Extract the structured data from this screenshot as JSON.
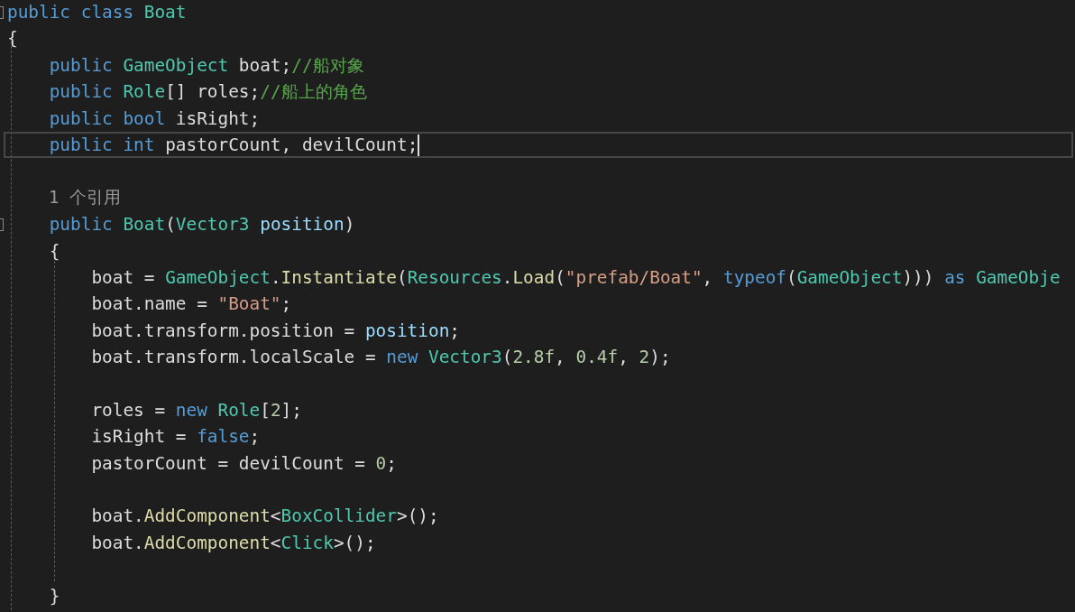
{
  "editor": {
    "lines": [
      {
        "kind": "code",
        "current": false,
        "fold": true,
        "tokens": [
          {
            "text": "public class ",
            "kind": "keyword"
          },
          {
            "text": "Boat",
            "kind": "type"
          }
        ]
      },
      {
        "kind": "code",
        "current": false,
        "fold": false,
        "tokens": [
          {
            "text": "{",
            "kind": "plain"
          }
        ]
      },
      {
        "kind": "code",
        "current": false,
        "fold": false,
        "tokens": [
          {
            "text": "    public ",
            "kind": "keyword"
          },
          {
            "text": "GameObject",
            "kind": "type"
          },
          {
            "text": " boat;",
            "kind": "plain"
          },
          {
            "text": "//船对象",
            "kind": "comment"
          }
        ]
      },
      {
        "kind": "code",
        "current": false,
        "fold": false,
        "tokens": [
          {
            "text": "    public ",
            "kind": "keyword"
          },
          {
            "text": "Role",
            "kind": "type"
          },
          {
            "text": "[] roles;",
            "kind": "plain"
          },
          {
            "text": "//船上的角色",
            "kind": "comment"
          }
        ]
      },
      {
        "kind": "code",
        "current": false,
        "fold": false,
        "tokens": [
          {
            "text": "    public bool ",
            "kind": "keyword"
          },
          {
            "text": "isRight;",
            "kind": "plain"
          }
        ]
      },
      {
        "kind": "code",
        "current": true,
        "fold": false,
        "tokens": [
          {
            "text": "    public int ",
            "kind": "keyword"
          },
          {
            "text": "pastorCount, devilCount;",
            "kind": "plain"
          }
        ]
      },
      {
        "kind": "blank",
        "current": false,
        "fold": false
      },
      {
        "kind": "lens",
        "current": false,
        "fold": false,
        "text": "1 个引用"
      },
      {
        "kind": "code",
        "current": false,
        "fold": true,
        "tokens": [
          {
            "text": "    public ",
            "kind": "keyword"
          },
          {
            "text": "Boat",
            "kind": "type"
          },
          {
            "text": "(",
            "kind": "plain"
          },
          {
            "text": "Vector3 ",
            "kind": "type"
          },
          {
            "text": "position",
            "kind": "param"
          },
          {
            "text": ")",
            "kind": "plain"
          }
        ]
      },
      {
        "kind": "code",
        "current": false,
        "fold": false,
        "tokens": [
          {
            "text": "    {",
            "kind": "plain"
          }
        ]
      },
      {
        "kind": "code",
        "current": false,
        "fold": false,
        "tokens": [
          {
            "text": "        boat = ",
            "kind": "plain"
          },
          {
            "text": "GameObject",
            "kind": "type"
          },
          {
            "text": ".",
            "kind": "plain"
          },
          {
            "text": "Instantiate",
            "kind": "method"
          },
          {
            "text": "(",
            "kind": "plain"
          },
          {
            "text": "Resources",
            "kind": "type"
          },
          {
            "text": ".",
            "kind": "plain"
          },
          {
            "text": "Load",
            "kind": "method"
          },
          {
            "text": "(",
            "kind": "plain"
          },
          {
            "text": "\"prefab/Boat\"",
            "kind": "string"
          },
          {
            "text": ", ",
            "kind": "plain"
          },
          {
            "text": "typeof",
            "kind": "keyword"
          },
          {
            "text": "(",
            "kind": "plain"
          },
          {
            "text": "GameObject",
            "kind": "type"
          },
          {
            "text": "))) ",
            "kind": "plain"
          },
          {
            "text": "as ",
            "kind": "keyword"
          },
          {
            "text": "GameObje",
            "kind": "type"
          }
        ]
      },
      {
        "kind": "code",
        "current": false,
        "fold": false,
        "tokens": [
          {
            "text": "        boat.name = ",
            "kind": "plain"
          },
          {
            "text": "\"Boat\"",
            "kind": "string"
          },
          {
            "text": ";",
            "kind": "plain"
          }
        ]
      },
      {
        "kind": "code",
        "current": false,
        "fold": false,
        "tokens": [
          {
            "text": "        boat.transform.position = ",
            "kind": "plain"
          },
          {
            "text": "position",
            "kind": "param"
          },
          {
            "text": ";",
            "kind": "plain"
          }
        ]
      },
      {
        "kind": "code",
        "current": false,
        "fold": false,
        "tokens": [
          {
            "text": "        boat.transform.localScale = ",
            "kind": "plain"
          },
          {
            "text": "new ",
            "kind": "keyword"
          },
          {
            "text": "Vector3",
            "kind": "type"
          },
          {
            "text": "(",
            "kind": "plain"
          },
          {
            "text": "2.8f",
            "kind": "number"
          },
          {
            "text": ", ",
            "kind": "plain"
          },
          {
            "text": "0.4f",
            "kind": "number"
          },
          {
            "text": ", ",
            "kind": "plain"
          },
          {
            "text": "2",
            "kind": "number"
          },
          {
            "text": ");",
            "kind": "plain"
          }
        ]
      },
      {
        "kind": "blank",
        "current": false,
        "fold": false
      },
      {
        "kind": "code",
        "current": false,
        "fold": false,
        "tokens": [
          {
            "text": "        roles = ",
            "kind": "plain"
          },
          {
            "text": "new ",
            "kind": "keyword"
          },
          {
            "text": "Role",
            "kind": "type"
          },
          {
            "text": "[",
            "kind": "plain"
          },
          {
            "text": "2",
            "kind": "number"
          },
          {
            "text": "];",
            "kind": "plain"
          }
        ]
      },
      {
        "kind": "code",
        "current": false,
        "fold": false,
        "tokens": [
          {
            "text": "        isRight = ",
            "kind": "plain"
          },
          {
            "text": "false",
            "kind": "keyword"
          },
          {
            "text": ";",
            "kind": "plain"
          }
        ]
      },
      {
        "kind": "code",
        "current": false,
        "fold": false,
        "tokens": [
          {
            "text": "        pastorCount = devilCount = ",
            "kind": "plain"
          },
          {
            "text": "0",
            "kind": "number"
          },
          {
            "text": ";",
            "kind": "plain"
          }
        ]
      },
      {
        "kind": "blank",
        "current": false,
        "fold": false
      },
      {
        "kind": "code",
        "current": false,
        "fold": false,
        "tokens": [
          {
            "text": "        boat.",
            "kind": "plain"
          },
          {
            "text": "AddComponent",
            "kind": "method"
          },
          {
            "text": "<",
            "kind": "plain"
          },
          {
            "text": "BoxCollider",
            "kind": "type"
          },
          {
            "text": ">();",
            "kind": "plain"
          }
        ]
      },
      {
        "kind": "code",
        "current": false,
        "fold": false,
        "tokens": [
          {
            "text": "        boat.",
            "kind": "plain"
          },
          {
            "text": "AddComponent",
            "kind": "method"
          },
          {
            "text": "<",
            "kind": "plain"
          },
          {
            "text": "Click",
            "kind": "type"
          },
          {
            "text": ">();",
            "kind": "plain"
          }
        ]
      },
      {
        "kind": "blank",
        "current": false,
        "fold": false
      },
      {
        "kind": "code",
        "current": false,
        "fold": false,
        "tokens": [
          {
            "text": "    }",
            "kind": "plain"
          }
        ]
      }
    ]
  }
}
